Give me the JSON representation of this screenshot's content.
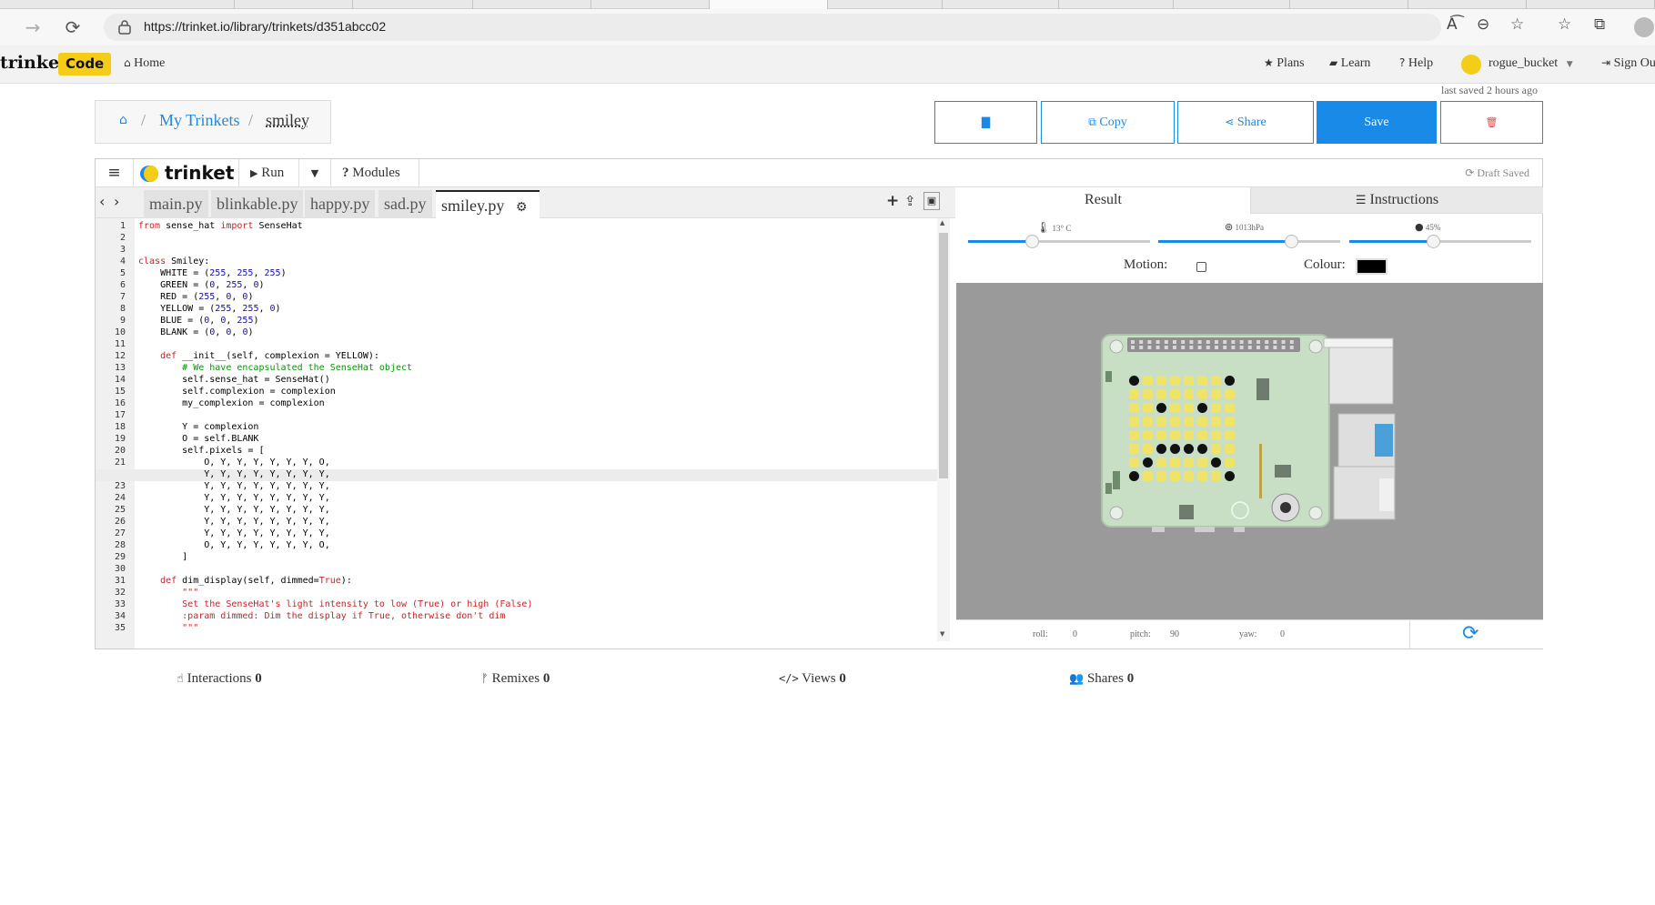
{
  "browser": {
    "url": "https://trinket.io/library/trinkets/d351abcc02",
    "back_icon": "arrow-left-icon",
    "refresh_icon": "refresh-icon"
  },
  "site_nav": {
    "brand": "trinket",
    "badge": "Code",
    "home": "Home",
    "plans": "Plans",
    "learn": "Learn",
    "help": "Help",
    "username": "rogue_bucket",
    "sign_out": "Sign Ou"
  },
  "breadcrumb": {
    "sep": "/",
    "library": "My Trinkets",
    "current": "smiley"
  },
  "last_saved": "last saved 2 hours ago",
  "actions": {
    "copy": "Copy",
    "share": "Share",
    "save": "Save"
  },
  "toolbar": {
    "logo": "trinket",
    "run": "Run",
    "modules": "Modules",
    "draft": "Draft Saved"
  },
  "files": [
    "main.py",
    "blinkable.py",
    "happy.py",
    "sad.py",
    "smiley.py"
  ],
  "code": {
    "line_numbers": [
      "1",
      "2",
      "3",
      "4",
      "5",
      "6",
      "7",
      "8",
      "9",
      "10",
      "11",
      "12",
      "13",
      "14",
      "15",
      "16",
      "17",
      "18",
      "19",
      "20",
      "21",
      "22",
      "23",
      "24",
      "25",
      "26",
      "27",
      "28",
      "29",
      "30",
      "31",
      "32",
      "33",
      "34",
      "35"
    ],
    "lines": [
      "from sense_hat import SenseHat",
      "",
      "",
      "class Smiley:",
      "    WHITE = (255, 255, 255)",
      "    GREEN = (0, 255, 0)",
      "    RED = (255, 0, 0)",
      "    YELLOW = (255, 255, 0)",
      "    BLUE = (0, 0, 255)",
      "    BLANK = (0, 0, 0)",
      "",
      "    def __init__(self, complexion = YELLOW):",
      "        # We have encapsulated the SenseHat object",
      "        self.sense_hat = SenseHat()",
      "        self.complexion = complexion",
      "        my_complexion = complexion",
      "",
      "        Y = complexion",
      "        O = self.BLANK",
      "        self.pixels = [",
      "            O, Y, Y, Y, Y, Y, Y, O,",
      "            Y, Y, Y, Y, Y, Y, Y, Y,",
      "            Y, Y, Y, Y, Y, Y, Y, Y,",
      "            Y, Y, Y, Y, Y, Y, Y, Y,",
      "            Y, Y, Y, Y, Y, Y, Y, Y,",
      "            Y, Y, Y, Y, Y, Y, Y, Y,",
      "            Y, Y, Y, Y, Y, Y, Y, Y,",
      "            O, Y, Y, Y, Y, Y, Y, O,",
      "        ]",
      "",
      "    def dim_display(self, dimmed=True):",
      "        \"\"\"",
      "        Set the SenseHat's light intensity to low (True) or high (False)",
      "        :param dimmed: Dim the display if True, otherwise don't dim",
      "        \"\"\""
    ]
  },
  "result": {
    "tab_result": "Result",
    "tab_instructions": "Instructions",
    "temperature": "13° C",
    "pressure": "1013hPa",
    "humidity": "45%",
    "temperature_level": 0.35,
    "pressure_level": 0.73,
    "humidity_level": 0.46,
    "motion_label": "Motion:",
    "colour_label": "Colour:",
    "colour_value": "#000000",
    "roll_label": "roll:",
    "roll": "0",
    "pitch_label": "pitch:",
    "pitch": "90",
    "yaw_label": "yaw:",
    "yaw": "0"
  },
  "stats": {
    "interactions_label": "Interactions",
    "interactions": "0",
    "remixes_label": "Remixes",
    "remixes": "0",
    "views_label": "Views",
    "views": "0",
    "shares_label": "Shares",
    "shares": "0"
  },
  "colors": {
    "accent": "#1a8ae8",
    "danger": "#e64545",
    "badge": "#f5cc17",
    "led_on": "#f0e36a",
    "led_off": "#111111",
    "board": "#c8dfc6"
  },
  "led_matrix": [
    [
      0,
      1,
      1,
      1,
      1,
      1,
      1,
      0
    ],
    [
      1,
      1,
      1,
      1,
      1,
      1,
      1,
      1
    ],
    [
      1,
      1,
      0,
      1,
      1,
      0,
      1,
      1
    ],
    [
      1,
      1,
      1,
      1,
      1,
      1,
      1,
      1
    ],
    [
      1,
      1,
      1,
      1,
      1,
      1,
      1,
      1
    ],
    [
      1,
      1,
      0,
      0,
      0,
      0,
      1,
      1
    ],
    [
      1,
      0,
      1,
      1,
      1,
      1,
      0,
      1
    ],
    [
      0,
      1,
      1,
      1,
      1,
      1,
      1,
      0
    ]
  ]
}
